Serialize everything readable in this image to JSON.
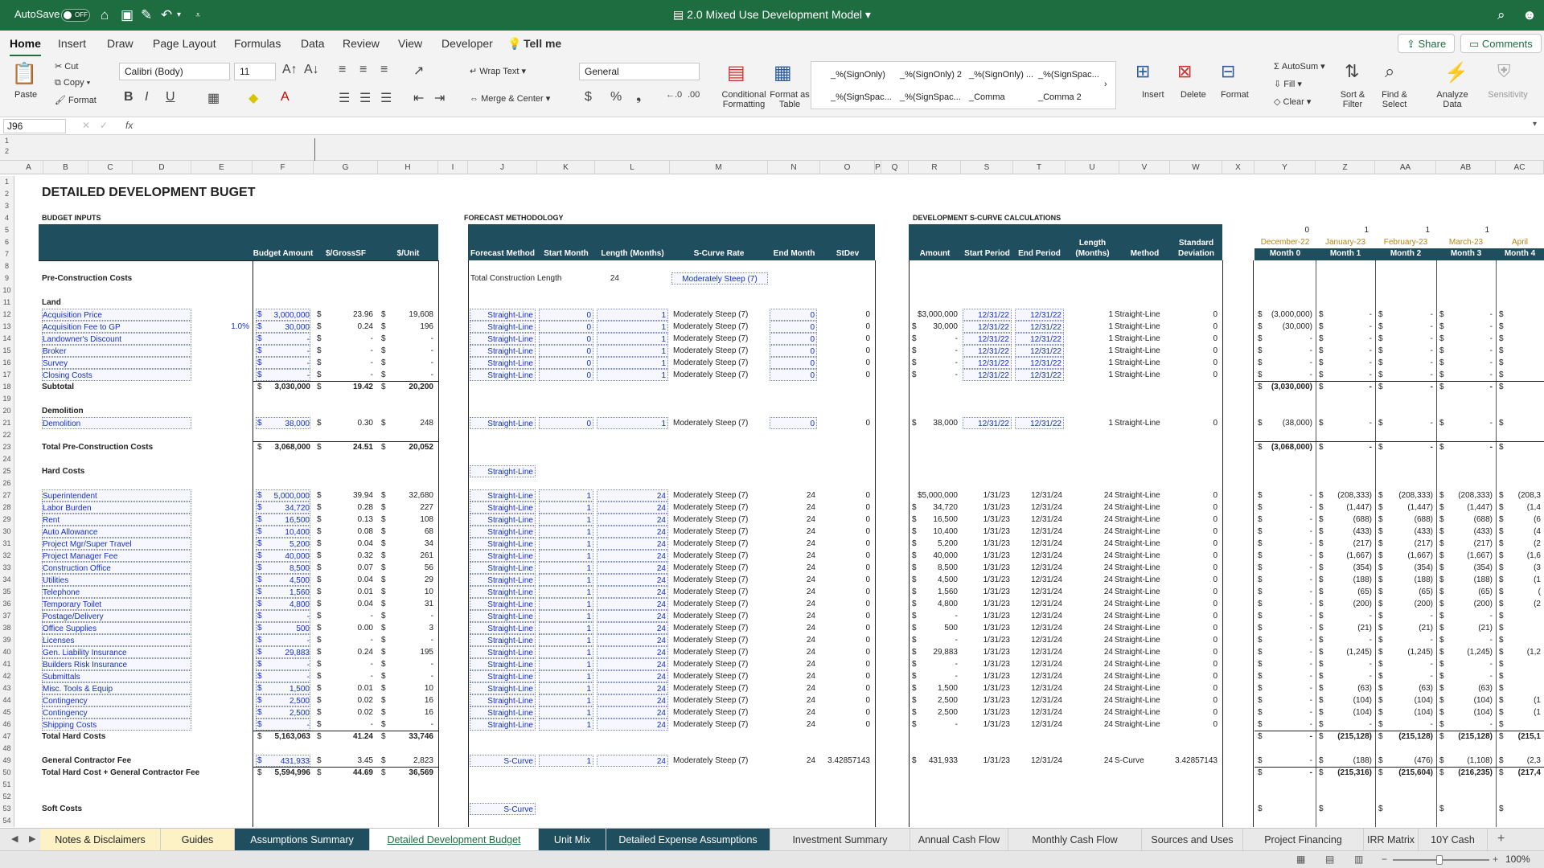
{
  "titlebar": {
    "autosave": "AutoSave",
    "toggle": "OFF",
    "title": "2.0 Mixed Use Development Model"
  },
  "menubar": {
    "tabs": [
      "Home",
      "Insert",
      "Draw",
      "Page Layout",
      "Formulas",
      "Data",
      "Review",
      "View",
      "Developer"
    ],
    "tell_me": "Tell me",
    "share": "Share",
    "comments": "Comments"
  },
  "ribbon": {
    "paste": "Paste",
    "cut": "Cut",
    "copy": "Copy",
    "format": "Format",
    "font": "Calibri (Body)",
    "size": "11",
    "wrap_text": "Wrap Text",
    "merge_center": "Merge & Center",
    "number_format": "General",
    "cond_format": "Conditional Formatting",
    "format_table": "Format as Table",
    "styles": [
      "_%(SignOnly)",
      "_%(SignOnly) 2",
      "_%(SignOnly) ...",
      "_%(SignSpac...",
      "_%(SignSpac...",
      "_%(SignSpac...",
      "_Comma",
      "_Comma 2"
    ],
    "insert": "Insert",
    "delete": "Delete",
    "format2": "Format",
    "autosum": "AutoSum",
    "fill": "Fill",
    "clear": "Clear",
    "sort_filter": "Sort & Filter",
    "find_select": "Find & Select",
    "analyze": "Analyze Data",
    "sensitivity": "Sensitivity"
  },
  "formula_bar": {
    "cell": "J96",
    "fx": "fx",
    "value": ""
  },
  "columns": [
    "A",
    "B",
    "C",
    "D",
    "E",
    "F",
    "G",
    "H",
    "I",
    "J",
    "K",
    "L",
    "M",
    "N",
    "O",
    "P",
    "Q",
    "R",
    "S",
    "T",
    "U",
    "V",
    "W",
    "X",
    "Y",
    "Z",
    "AA",
    "AB",
    "AC"
  ],
  "sheet": {
    "title": "DETAILED DEVELOPMENT BUGET",
    "sections": [
      "BUDGET INPUTS",
      "FORECAST METHODOLOGY",
      "DEVELOPMENT S-CURVE CALCULATIONS"
    ],
    "headers_left": [
      "Budget Amount",
      "$/GrossSF",
      "$/Unit"
    ],
    "headers_mid": [
      "Forecast Method",
      "Start Month",
      "Length (Months)",
      "S-Curve Rate",
      "End Month",
      "StDev"
    ],
    "headers_right": [
      "Amount",
      "Start Period",
      "End Period",
      "Length (Months)",
      "Method",
      "Standard Deviation"
    ],
    "month_index": [
      "0",
      "1",
      "1",
      "1"
    ],
    "month_dates": [
      "December-22",
      "January-23",
      "February-23",
      "March-23",
      "April"
    ],
    "month_labels": [
      "Month 0",
      "Month 1",
      "Month 2",
      "Month 3",
      "Month 4"
    ],
    "total_construction_label": "Total Construction Length",
    "total_construction_value": "24",
    "total_construction_rate": "Moderately Steep (7)"
  },
  "rows": [
    {
      "n": "1"
    },
    {
      "n": "2"
    },
    {
      "n": "3"
    },
    {
      "n": "4"
    },
    {
      "n": "5"
    },
    {
      "n": "6"
    },
    {
      "n": "7"
    },
    {
      "n": "8"
    },
    {
      "n": "9",
      "label": "Pre-Construction Costs",
      "bold": true
    },
    {
      "n": "10"
    },
    {
      "n": "11",
      "label": "Land",
      "bold": true
    },
    {
      "n": "12",
      "label": "Acquisition Price",
      "input": true,
      "f": "3,000,000",
      "g": "23.96",
      "h": "19,608",
      "j": "Straight-Line",
      "k": "0",
      "l": "1",
      "m": "Moderately Steep (7)",
      "nn": "0",
      "o": "0",
      "rr": "$3,000,000",
      "s": "12/31/22",
      "t": "12/31/22",
      "u": "1",
      "v": "Straight-Line",
      "w": "0",
      "y": "(3,000,000)",
      "z": "-",
      "aa": "-",
      "ab": "-",
      "ac": ""
    },
    {
      "n": "13",
      "label": "Acquisition Fee to GP",
      "input": true,
      "e": "1.0%",
      "f": "30,000",
      "g": "0.24",
      "h": "196",
      "j": "Straight-Line",
      "k": "0",
      "l": "1",
      "m": "Moderately Steep (7)",
      "nn": "0",
      "o": "0",
      "rr": "30,000",
      "s": "12/31/22",
      "t": "12/31/22",
      "u": "1",
      "v": "Straight-Line",
      "w": "0",
      "y": "(30,000)",
      "z": "-",
      "aa": "-",
      "ab": "-",
      "ac": ""
    },
    {
      "n": "14",
      "label": "Landowner's Discount",
      "input": true,
      "f": "-",
      "g": "-",
      "h": "-",
      "j": "Straight-Line",
      "k": "0",
      "l": "1",
      "m": "Moderately Steep (7)",
      "nn": "0",
      "o": "0",
      "rr": "-",
      "s": "12/31/22",
      "t": "12/31/22",
      "u": "1",
      "v": "Straight-Line",
      "w": "0",
      "y": "-",
      "z": "-",
      "aa": "-",
      "ab": "-",
      "ac": ""
    },
    {
      "n": "15",
      "label": "Broker",
      "input": true,
      "f": "-",
      "g": "-",
      "h": "-",
      "j": "Straight-Line",
      "k": "0",
      "l": "1",
      "m": "Moderately Steep (7)",
      "nn": "0",
      "o": "0",
      "rr": "-",
      "s": "12/31/22",
      "t": "12/31/22",
      "u": "1",
      "v": "Straight-Line",
      "w": "0",
      "y": "-",
      "z": "-",
      "aa": "-",
      "ab": "-",
      "ac": ""
    },
    {
      "n": "16",
      "label": "Survey",
      "input": true,
      "f": "-",
      "g": "-",
      "h": "-",
      "j": "Straight-Line",
      "k": "0",
      "l": "1",
      "m": "Moderately Steep (7)",
      "nn": "0",
      "o": "0",
      "rr": "-",
      "s": "12/31/22",
      "t": "12/31/22",
      "u": "1",
      "v": "Straight-Line",
      "w": "0",
      "y": "-",
      "z": "-",
      "aa": "-",
      "ab": "-",
      "ac": ""
    },
    {
      "n": "17",
      "label": "Closing Costs",
      "input": true,
      "f": "-",
      "g": "-",
      "h": "-",
      "j": "Straight-Line",
      "k": "0",
      "l": "1",
      "m": "Moderately Steep (7)",
      "nn": "0",
      "o": "0",
      "rr": "-",
      "s": "12/31/22",
      "t": "12/31/22",
      "u": "1",
      "v": "Straight-Line",
      "w": "0",
      "y": "-",
      "z": "-",
      "aa": "-",
      "ab": "-",
      "ac": ""
    },
    {
      "n": "18",
      "label": "Subtotal",
      "bold": true,
      "f": "3,030,000",
      "g": "19.42",
      "h": "20,200",
      "y": "(3,030,000)",
      "z": "-",
      "aa": "-",
      "ab": "-",
      "ac": "",
      "total": true
    },
    {
      "n": "19"
    },
    {
      "n": "20",
      "label": "Demolition",
      "bold": true
    },
    {
      "n": "21",
      "label": "Demolition",
      "input": true,
      "f": "38,000",
      "g": "0.30",
      "h": "248",
      "j": "Straight-Line",
      "k": "0",
      "l": "1",
      "m": "Moderately Steep (7)",
      "nn": "0",
      "o": "0",
      "rr": "38,000",
      "s": "12/31/22",
      "t": "12/31/22",
      "u": "1",
      "v": "Straight-Line",
      "w": "0",
      "y": "(38,000)",
      "z": "-",
      "aa": "-",
      "ab": "-",
      "ac": ""
    },
    {
      "n": "22"
    },
    {
      "n": "23",
      "label": "Total Pre-Construction Costs",
      "bold": true,
      "f": "3,068,000",
      "g": "24.51",
      "h": "20,052",
      "y": "(3,068,000)",
      "z": "-",
      "aa": "-",
      "ab": "-",
      "ac": "",
      "total": true
    },
    {
      "n": "24"
    },
    {
      "n": "25",
      "label": "Hard Costs",
      "bold": true,
      "j": "Straight-Line",
      "jonly": true
    },
    {
      "n": "26"
    },
    {
      "n": "27",
      "label": "Superintendent",
      "input": true,
      "f": "5,000,000",
      "g": "39.94",
      "h": "32,680",
      "j": "Straight-Line",
      "k": "1",
      "l": "24",
      "m": "Moderately Steep (7)",
      "nn": "24",
      "o": "0",
      "rr": "$5,000,000",
      "s": "1/31/23",
      "t": "12/31/24",
      "u": "24",
      "v": "Straight-Line",
      "w": "0",
      "y": "-",
      "z": "(208,333)",
      "aa": "(208,333)",
      "ab": "(208,333)",
      "ac": "(208,3"
    },
    {
      "n": "28",
      "label": "Labor Burden",
      "input": true,
      "f": "34,720",
      "g": "0.28",
      "h": "227",
      "j": "Straight-Line",
      "k": "1",
      "l": "24",
      "m": "Moderately Steep (7)",
      "nn": "24",
      "o": "0",
      "rr": "34,720",
      "s": "1/31/23",
      "t": "12/31/24",
      "u": "24",
      "v": "Straight-Line",
      "w": "0",
      "y": "-",
      "z": "(1,447)",
      "aa": "(1,447)",
      "ab": "(1,447)",
      "ac": "(1,4"
    },
    {
      "n": "29",
      "label": "Rent",
      "input": true,
      "f": "16,500",
      "g": "0.13",
      "h": "108",
      "j": "Straight-Line",
      "k": "1",
      "l": "24",
      "m": "Moderately Steep (7)",
      "nn": "24",
      "o": "0",
      "rr": "16,500",
      "s": "1/31/23",
      "t": "12/31/24",
      "u": "24",
      "v": "Straight-Line",
      "w": "0",
      "y": "-",
      "z": "(688)",
      "aa": "(688)",
      "ab": "(688)",
      "ac": "(6"
    },
    {
      "n": "30",
      "label": "Auto Allowance",
      "input": true,
      "f": "10,400",
      "g": "0.08",
      "h": "68",
      "j": "Straight-Line",
      "k": "1",
      "l": "24",
      "m": "Moderately Steep (7)",
      "nn": "24",
      "o": "0",
      "rr": "10,400",
      "s": "1/31/23",
      "t": "12/31/24",
      "u": "24",
      "v": "Straight-Line",
      "w": "0",
      "y": "-",
      "z": "(433)",
      "aa": "(433)",
      "ab": "(433)",
      "ac": "(4"
    },
    {
      "n": "31",
      "label": "Project Mgr/Super Travel",
      "input": true,
      "f": "5,200",
      "g": "0.04",
      "h": "34",
      "j": "Straight-Line",
      "k": "1",
      "l": "24",
      "m": "Moderately Steep (7)",
      "nn": "24",
      "o": "0",
      "rr": "5,200",
      "s": "1/31/23",
      "t": "12/31/24",
      "u": "24",
      "v": "Straight-Line",
      "w": "0",
      "y": "-",
      "z": "(217)",
      "aa": "(217)",
      "ab": "(217)",
      "ac": "(2"
    },
    {
      "n": "32",
      "label": "Project Manager Fee",
      "input": true,
      "f": "40,000",
      "g": "0.32",
      "h": "261",
      "j": "Straight-Line",
      "k": "1",
      "l": "24",
      "m": "Moderately Steep (7)",
      "nn": "24",
      "o": "0",
      "rr": "40,000",
      "s": "1/31/23",
      "t": "12/31/24",
      "u": "24",
      "v": "Straight-Line",
      "w": "0",
      "y": "-",
      "z": "(1,667)",
      "aa": "(1,667)",
      "ab": "(1,667)",
      "ac": "(1,6"
    },
    {
      "n": "33",
      "label": "Construction Office",
      "input": true,
      "f": "8,500",
      "g": "0.07",
      "h": "56",
      "j": "Straight-Line",
      "k": "1",
      "l": "24",
      "m": "Moderately Steep (7)",
      "nn": "24",
      "o": "0",
      "rr": "8,500",
      "s": "1/31/23",
      "t": "12/31/24",
      "u": "24",
      "v": "Straight-Line",
      "w": "0",
      "y": "-",
      "z": "(354)",
      "aa": "(354)",
      "ab": "(354)",
      "ac": "(3"
    },
    {
      "n": "34",
      "label": "Utilities",
      "input": true,
      "f": "4,500",
      "g": "0.04",
      "h": "29",
      "j": "Straight-Line",
      "k": "1",
      "l": "24",
      "m": "Moderately Steep (7)",
      "nn": "24",
      "o": "0",
      "rr": "4,500",
      "s": "1/31/23",
      "t": "12/31/24",
      "u": "24",
      "v": "Straight-Line",
      "w": "0",
      "y": "-",
      "z": "(188)",
      "aa": "(188)",
      "ab": "(188)",
      "ac": "(1"
    },
    {
      "n": "35",
      "label": "Telephone",
      "input": true,
      "f": "1,560",
      "g": "0.01",
      "h": "10",
      "j": "Straight-Line",
      "k": "1",
      "l": "24",
      "m": "Moderately Steep (7)",
      "nn": "24",
      "o": "0",
      "rr": "1,560",
      "s": "1/31/23",
      "t": "12/31/24",
      "u": "24",
      "v": "Straight-Line",
      "w": "0",
      "y": "-",
      "z": "(65)",
      "aa": "(65)",
      "ab": "(65)",
      "ac": "("
    },
    {
      "n": "36",
      "label": "Temporary Toilet",
      "input": true,
      "f": "4,800",
      "g": "0.04",
      "h": "31",
      "j": "Straight-Line",
      "k": "1",
      "l": "24",
      "m": "Moderately Steep (7)",
      "nn": "24",
      "o": "0",
      "rr": "4,800",
      "s": "1/31/23",
      "t": "12/31/24",
      "u": "24",
      "v": "Straight-Line",
      "w": "0",
      "y": "-",
      "z": "(200)",
      "aa": "(200)",
      "ab": "(200)",
      "ac": "(2"
    },
    {
      "n": "37",
      "label": "Postage/Delivery",
      "input": true,
      "f": "-",
      "g": "-",
      "h": "-",
      "j": "Straight-Line",
      "k": "1",
      "l": "24",
      "m": "Moderately Steep (7)",
      "nn": "24",
      "o": "0",
      "rr": "-",
      "s": "1/31/23",
      "t": "12/31/24",
      "u": "24",
      "v": "Straight-Line",
      "w": "0",
      "y": "-",
      "z": "-",
      "aa": "-",
      "ab": "-",
      "ac": ""
    },
    {
      "n": "38",
      "label": "Office Supplies",
      "input": true,
      "f": "500",
      "g": "0.00",
      "h": "3",
      "j": "Straight-Line",
      "k": "1",
      "l": "24",
      "m": "Moderately Steep (7)",
      "nn": "24",
      "o": "0",
      "rr": "500",
      "s": "1/31/23",
      "t": "12/31/24",
      "u": "24",
      "v": "Straight-Line",
      "w": "0",
      "y": "-",
      "z": "(21)",
      "aa": "(21)",
      "ab": "(21)",
      "ac": ""
    },
    {
      "n": "39",
      "label": "Licenses",
      "input": true,
      "f": "-",
      "g": "-",
      "h": "-",
      "j": "Straight-Line",
      "k": "1",
      "l": "24",
      "m": "Moderately Steep (7)",
      "nn": "24",
      "o": "0",
      "rr": "-",
      "s": "1/31/23",
      "t": "12/31/24",
      "u": "24",
      "v": "Straight-Line",
      "w": "0",
      "y": "-",
      "z": "-",
      "aa": "-",
      "ab": "-",
      "ac": ""
    },
    {
      "n": "40",
      "label": "Gen. Liability Insurance",
      "input": true,
      "f": "29,883",
      "g": "0.24",
      "h": "195",
      "j": "Straight-Line",
      "k": "1",
      "l": "24",
      "m": "Moderately Steep (7)",
      "nn": "24",
      "o": "0",
      "rr": "29,883",
      "s": "1/31/23",
      "t": "12/31/24",
      "u": "24",
      "v": "Straight-Line",
      "w": "0",
      "y": "-",
      "z": "(1,245)",
      "aa": "(1,245)",
      "ab": "(1,245)",
      "ac": "(1,2"
    },
    {
      "n": "41",
      "label": "Builders Risk Insurance",
      "input": true,
      "f": "-",
      "g": "-",
      "h": "-",
      "j": "Straight-Line",
      "k": "1",
      "l": "24",
      "m": "Moderately Steep (7)",
      "nn": "24",
      "o": "0",
      "rr": "-",
      "s": "1/31/23",
      "t": "12/31/24",
      "u": "24",
      "v": "Straight-Line",
      "w": "0",
      "y": "-",
      "z": "-",
      "aa": "-",
      "ab": "-",
      "ac": ""
    },
    {
      "n": "42",
      "label": "Submittals",
      "input": true,
      "f": "-",
      "g": "-",
      "h": "-",
      "j": "Straight-Line",
      "k": "1",
      "l": "24",
      "m": "Moderately Steep (7)",
      "nn": "24",
      "o": "0",
      "rr": "-",
      "s": "1/31/23",
      "t": "12/31/24",
      "u": "24",
      "v": "Straight-Line",
      "w": "0",
      "y": "-",
      "z": "-",
      "aa": "-",
      "ab": "-",
      "ac": ""
    },
    {
      "n": "43",
      "label": "Misc. Tools & Equip",
      "input": true,
      "f": "1,500",
      "g": "0.01",
      "h": "10",
      "j": "Straight-Line",
      "k": "1",
      "l": "24",
      "m": "Moderately Steep (7)",
      "nn": "24",
      "o": "0",
      "rr": "1,500",
      "s": "1/31/23",
      "t": "12/31/24",
      "u": "24",
      "v": "Straight-Line",
      "w": "0",
      "y": "-",
      "z": "(63)",
      "aa": "(63)",
      "ab": "(63)",
      "ac": ""
    },
    {
      "n": "44",
      "label": "Contingency",
      "input": true,
      "f": "2,500",
      "g": "0.02",
      "h": "16",
      "j": "Straight-Line",
      "k": "1",
      "l": "24",
      "m": "Moderately Steep (7)",
      "nn": "24",
      "o": "0",
      "rr": "2,500",
      "s": "1/31/23",
      "t": "12/31/24",
      "u": "24",
      "v": "Straight-Line",
      "w": "0",
      "y": "-",
      "z": "(104)",
      "aa": "(104)",
      "ab": "(104)",
      "ac": "(1"
    },
    {
      "n": "45",
      "label": "Contingency",
      "input": true,
      "f": "2,500",
      "g": "0.02",
      "h": "16",
      "j": "Straight-Line",
      "k": "1",
      "l": "24",
      "m": "Moderately Steep (7)",
      "nn": "24",
      "o": "0",
      "rr": "2,500",
      "s": "1/31/23",
      "t": "12/31/24",
      "u": "24",
      "v": "Straight-Line",
      "w": "0",
      "y": "-",
      "z": "(104)",
      "aa": "(104)",
      "ab": "(104)",
      "ac": "(1"
    },
    {
      "n": "46",
      "label": "Shipping Costs",
      "input": true,
      "f": "-",
      "g": "-",
      "h": "-",
      "j": "Straight-Line",
      "k": "1",
      "l": "24",
      "m": "Moderately Steep (7)",
      "nn": "24",
      "o": "0",
      "rr": "-",
      "s": "1/31/23",
      "t": "12/31/24",
      "u": "24",
      "v": "Straight-Line",
      "w": "0",
      "y": "-",
      "z": "-",
      "aa": "-",
      "ab": "-",
      "ac": ""
    },
    {
      "n": "47",
      "label": "Total Hard Costs",
      "bold": true,
      "f": "5,163,063",
      "g": "41.24",
      "h": "33,746",
      "y": "-",
      "z": "(215,128)",
      "aa": "(215,128)",
      "ab": "(215,128)",
      "ac": "(215,1",
      "total": true
    },
    {
      "n": "48"
    },
    {
      "n": "49",
      "label": "General Contractor Fee",
      "bold": true,
      "inputf": true,
      "f": "431,933",
      "g": "3.45",
      "h": "2,823",
      "j": "S-Curve",
      "k": "1",
      "l": "24",
      "m": "Moderately Steep (7)",
      "nn": "24",
      "o": "3.42857143",
      "rr": "431,933",
      "s": "1/31/23",
      "t": "12/31/24",
      "u": "24",
      "v": "S-Curve",
      "w": "3.42857143",
      "y": "-",
      "z": "(188)",
      "aa": "(476)",
      "ab": "(1,108)",
      "ac": "(2,3"
    },
    {
      "n": "50",
      "label": "Total Hard Cost + General Contractor Fee",
      "bold": true,
      "f": "5,594,996",
      "g": "44.69",
      "h": "36,569",
      "y": "-",
      "z": "(215,316)",
      "aa": "(215,604)",
      "ab": "(216,235)",
      "ac": "(217,4",
      "total": true
    },
    {
      "n": "51"
    },
    {
      "n": "52"
    },
    {
      "n": "53",
      "label": "Soft Costs",
      "bold": true,
      "j": "S-Curve",
      "jonly": true,
      "y": "",
      "z": "",
      "aa": "",
      "ab": "",
      "ac": ""
    },
    {
      "n": "54"
    }
  ],
  "sheet_tabs": [
    "Notes & Disclaimers",
    "Guides",
    "Assumptions Summary",
    "Detailed Development Budget",
    "Unit Mix",
    "Detailed Expense Assumptions",
    "Investment Summary",
    "Annual Cash Flow",
    "Monthly Cash Flow",
    "Sources and Uses",
    "Project Financing",
    "IRR Matrix",
    "10Y Cash"
  ],
  "status": {
    "zoom": "100%"
  }
}
